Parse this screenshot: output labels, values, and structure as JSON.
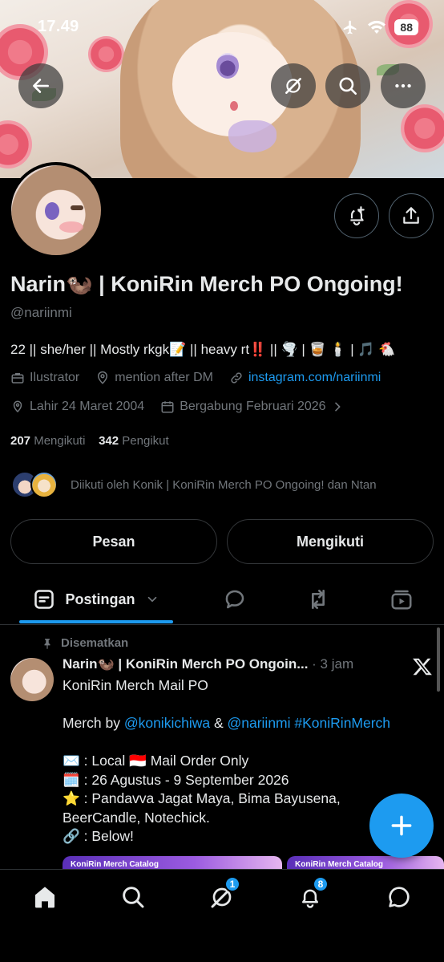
{
  "status_bar": {
    "time": "17.49",
    "battery": "88"
  },
  "profile": {
    "display_name": "Narin🦦 | KoniRin Merch PO Ongoing!",
    "handle": "@nariinmi",
    "bio": "22 || she/her || Mostly rkgk📝 || heavy rt‼️ || 🌪️ | 🥃 🕯️ | 🎵 🐔",
    "category": "Ilustrator",
    "location": "mention after DM",
    "website": "instagram.com/nariinmi",
    "birthday": "Lahir 24 Maret 2004",
    "joined": "Bergabung Februari 2026",
    "following_count": "207",
    "following_label": "Mengikuti",
    "followers_count": "342",
    "followers_label": "Pengikut",
    "followed_by": "Diikuti oleh Konik | KoniRin Merch PO Ongoing! dan Ntan"
  },
  "actions": {
    "message": "Pesan",
    "following": "Mengikuti"
  },
  "tabs": {
    "posts_label": "Postingan"
  },
  "post": {
    "pinned_label": "Disematkan",
    "author": "Narin🦦 | KoniRin Merch PO Ongoin...",
    "time": "· 3 jam",
    "line1": "KoniRin Merch Mail PO",
    "merch_by": "Merch by ",
    "mention1": "@konikichiwa",
    "amp": " & ",
    "mention2": "@nariinmi",
    "hashtag": "#KoniRinMerch",
    "line_local": "✉️ : Local 🇮🇩 Mail Order Only",
    "line_date": "🗓️ : 26 Agustus - 9 September 2026",
    "line_star": "⭐ : Pandavva Jagat Maya, Bima Bayusena,",
    "line_star2": "BeerCandle, Notechick.",
    "line_link": "🔗 : Below!",
    "catalog1": "KoniRin Merch Catalog",
    "catalog2": "KoniRin Merch Catalog"
  },
  "bottom_nav": {
    "grok_badge": "1",
    "notifications_badge": "8"
  },
  "colors": {
    "accent": "#1d9bf0",
    "background": "#000000",
    "muted": "#71767b"
  }
}
